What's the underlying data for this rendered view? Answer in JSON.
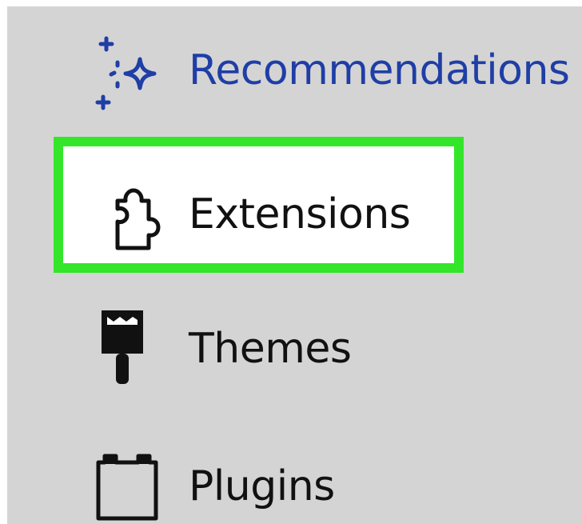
{
  "menu": {
    "items": [
      {
        "id": "recommendations",
        "label": "Recommendations",
        "icon": "sparkle-icon",
        "color": "#1f3ea6"
      },
      {
        "id": "extensions",
        "label": "Extensions",
        "icon": "puzzle-piece-icon",
        "highlighted": true,
        "highlight_color": "#33e62a"
      },
      {
        "id": "themes",
        "label": "Themes",
        "icon": "paintbrush-icon"
      },
      {
        "id": "plugins",
        "label": "Plugins",
        "icon": "plugin-block-icon"
      }
    ]
  }
}
